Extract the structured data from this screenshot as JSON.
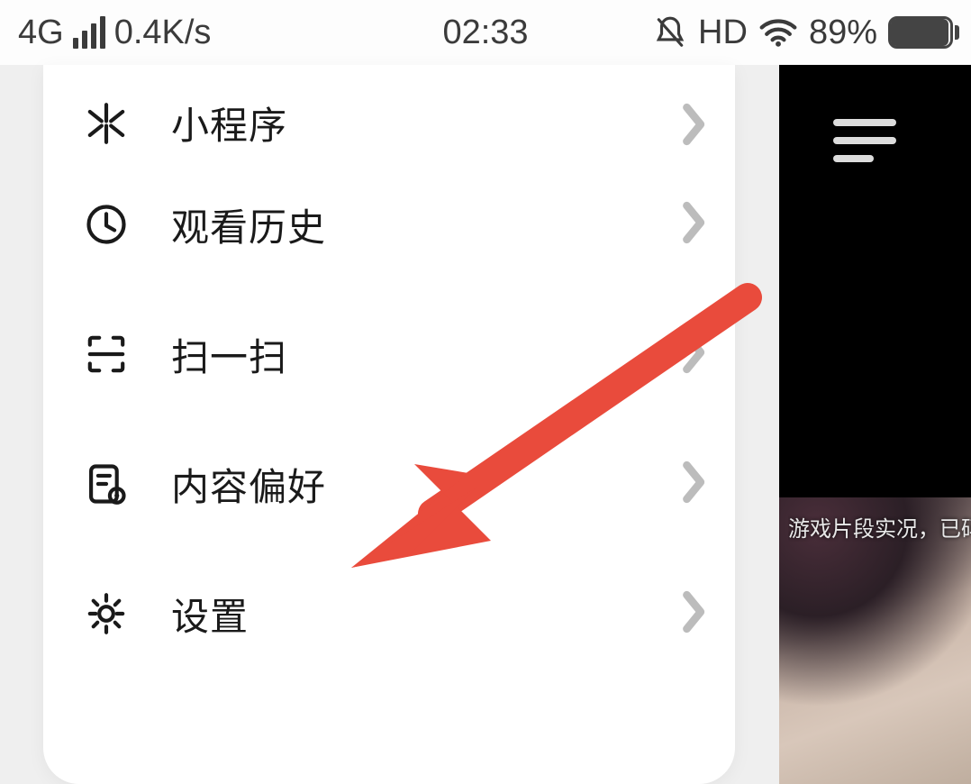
{
  "status_bar": {
    "network_type": "4G",
    "data_speed": "0.4K/s",
    "time": "02:33",
    "hd_label": "HD",
    "battery_pct": "89%"
  },
  "menu": {
    "items": [
      {
        "label": "小程序",
        "icon": "mini-program-icon"
      },
      {
        "label": "观看历史",
        "icon": "history-icon"
      },
      {
        "label": "扫一扫",
        "icon": "scan-icon"
      },
      {
        "label": "内容偏好",
        "icon": "content-pref-icon"
      },
      {
        "label": "设置",
        "icon": "settings-icon"
      }
    ]
  },
  "background_caption": "游戏片段实况，已码，",
  "annotation": {
    "type": "arrow",
    "color": "#e94b3c",
    "target_menu_index": 3
  }
}
